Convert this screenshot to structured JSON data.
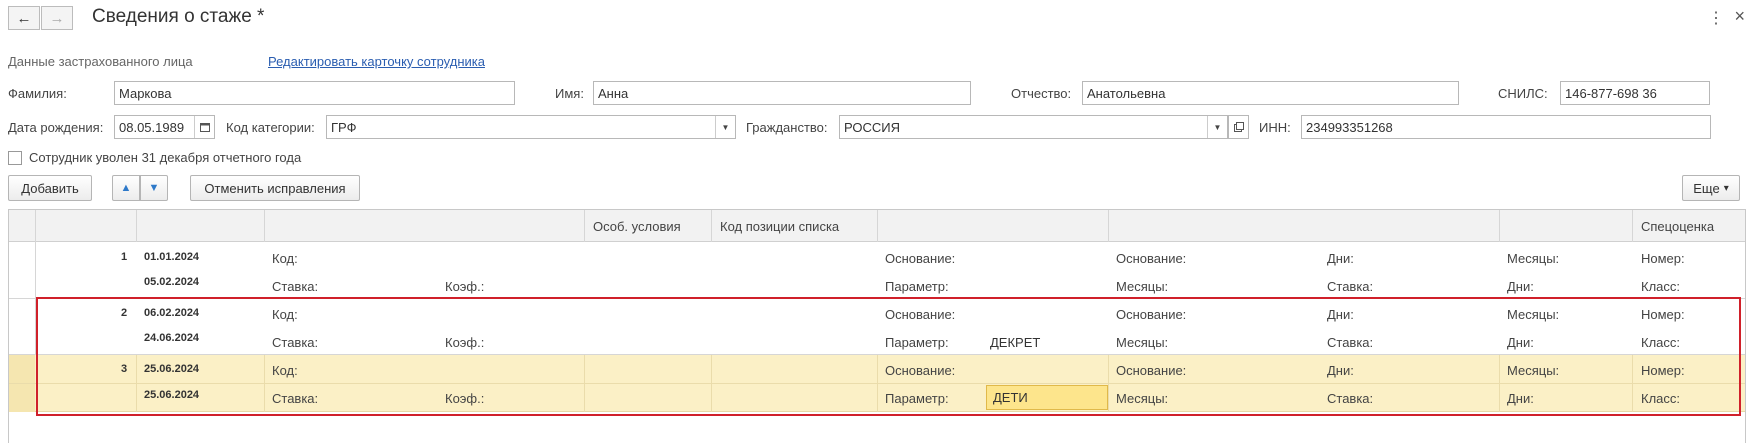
{
  "header": {
    "title": "Сведения о стаже *",
    "back_icon": "←",
    "forward_icon": "→",
    "more_icon": "⋮",
    "close_icon": "×"
  },
  "person": {
    "section_label": "Данные застрахованного лица",
    "edit_link": "Редактировать карточку сотрудника",
    "last_name_label": "Фамилия:",
    "last_name": "Маркова",
    "first_name_label": "Имя:",
    "first_name": "Анна",
    "patronymic_label": "Отчество:",
    "patronymic": "Анатольевна",
    "snils_label": "СНИЛС:",
    "snils": "146-877-698 36",
    "birth_label": "Дата рождения:",
    "birth_date": "08.05.1989",
    "category_label": "Код категории:",
    "category": "ГРФ",
    "citizenship_label": "Гражданство:",
    "citizenship": "РОССИЯ",
    "inn_label": "ИНН:",
    "inn": "234993351268",
    "fired_label": "Сотрудник уволен 31 декабря отчетного года"
  },
  "toolbar": {
    "add": "Добавить",
    "up_icon": "▲",
    "down_icon": "▼",
    "cancel_fix": "Отменить исправления",
    "more": "Еще",
    "more_arrow": "▾"
  },
  "grid": {
    "headers": {
      "osob": "Особ. условия",
      "kod_pos": "Код позиции списка",
      "spec": "Спецоценка"
    },
    "labels": {
      "kod": "Код:",
      "stavka": "Ставка:",
      "koef": "Коэф.:",
      "osnovanie": "Основание:",
      "parametr": "Параметр:",
      "mesyacy": "Месяцы:",
      "dni": "Дни:",
      "nomer": "Номер:",
      "klass": "Класс:"
    },
    "rows": [
      {
        "n": "1",
        "from": "01.01.2024",
        "to": "05.02.2024",
        "parametr_value": ""
      },
      {
        "n": "2",
        "from": "06.02.2024",
        "to": "24.06.2024",
        "parametr_value": "ДЕКРЕТ"
      },
      {
        "n": "3",
        "from": "25.06.2024",
        "to": "25.06.2024",
        "parametr_value": "ДЕТИ"
      }
    ]
  },
  "colors": {
    "selected_row": "#fbf0c6",
    "active_cell": "#fde58c",
    "highlight_border": "#d0202a",
    "link": "#2a5db0"
  }
}
